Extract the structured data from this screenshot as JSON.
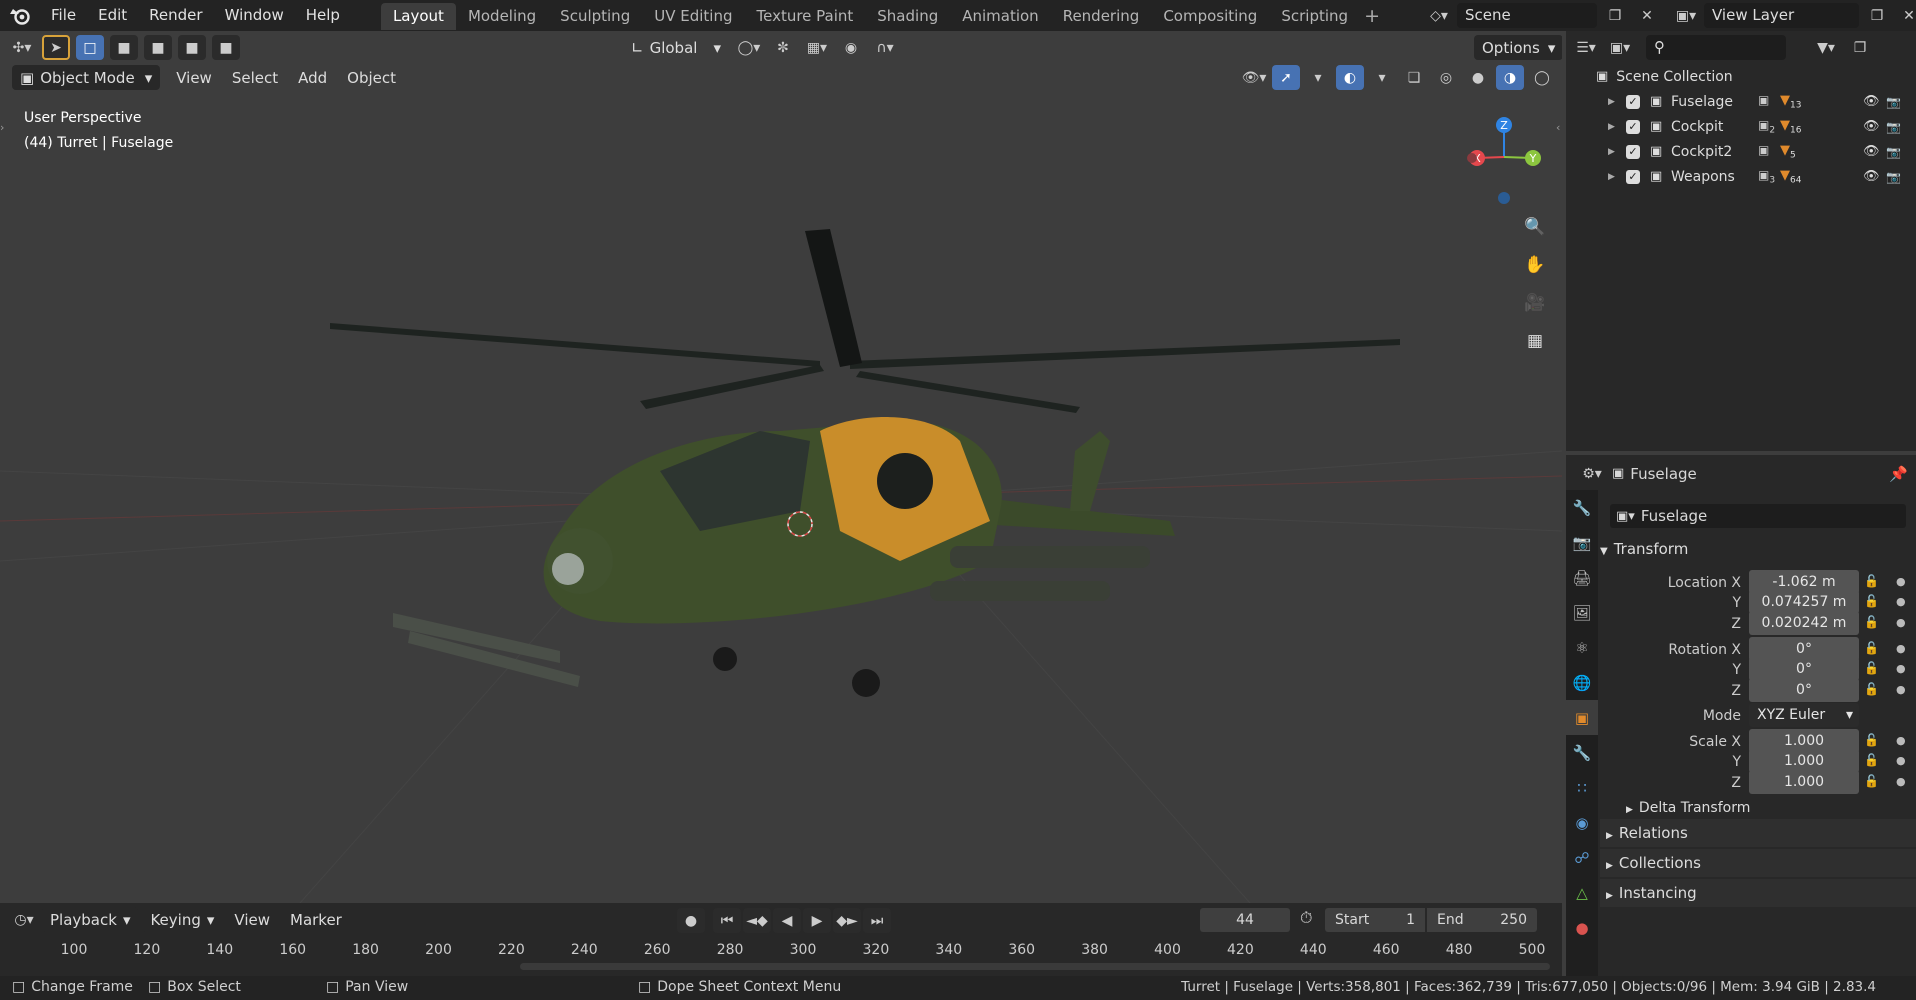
{
  "topbar": {
    "menus": [
      "File",
      "Edit",
      "Render",
      "Window",
      "Help"
    ],
    "tabs": [
      "Layout",
      "Modeling",
      "Sculpting",
      "UV Editing",
      "Texture Paint",
      "Shading",
      "Animation",
      "Rendering",
      "Compositing",
      "Scripting"
    ],
    "active_tab": "Layout",
    "scene_label": "Scene",
    "view_layer_label": "View Layer"
  },
  "viewport": {
    "orientation_label": "Global",
    "options_label": "Options",
    "mode_label": "Object Mode",
    "header_menus": [
      "View",
      "Select",
      "Add",
      "Object"
    ],
    "overlay_line1": "User Perspective",
    "overlay_line2": "(44) Turret | Fuselage",
    "gizmo": {
      "z": "Z",
      "x": "X",
      "y": "Y"
    }
  },
  "outliner": {
    "root": "Scene Collection",
    "items": [
      {
        "name": "Fuselage",
        "count_a": "",
        "count_b": "13"
      },
      {
        "name": "Cockpit",
        "count_a": "2",
        "count_b": "16"
      },
      {
        "name": "Cockpit2",
        "count_a": "",
        "count_b": "5"
      },
      {
        "name": "Weapons",
        "count_a": "3",
        "count_b": "64"
      }
    ]
  },
  "properties": {
    "header_name": "Fuselage",
    "object_name": "Fuselage",
    "transform_label": "Transform",
    "location": {
      "label_x": "Location X",
      "x": "-1.062 m",
      "y": "0.074257 m",
      "z": "0.020242 m"
    },
    "rotation": {
      "label_x": "Rotation X",
      "x": "0°",
      "y": "0°",
      "z": "0°"
    },
    "mode_label": "Mode",
    "mode_value": "XYZ Euler",
    "scale": {
      "label_x": "Scale X",
      "x": "1.000",
      "y": "1.000",
      "z": "1.000"
    },
    "axis_y": "Y",
    "axis_z": "Z",
    "delta": "Delta Transform",
    "relations": "Relations",
    "collections": "Collections",
    "instancing": "Instancing"
  },
  "timeline": {
    "playback": "Playback",
    "keying": "Keying",
    "view": "View",
    "marker": "Marker",
    "current_frame": "44",
    "start_label": "Start",
    "start_value": "1",
    "end_label": "End",
    "end_value": "250",
    "ticks": [
      "100",
      "120",
      "140",
      "160",
      "180",
      "200",
      "220",
      "240",
      "260",
      "280",
      "300",
      "320",
      "340",
      "360",
      "380",
      "400",
      "420",
      "440",
      "460",
      "480",
      "500"
    ]
  },
  "statusbar": {
    "change_frame": "Change Frame",
    "box_select": "Box Select",
    "pan_view": "Pan View",
    "context_menu": "Dope Sheet Context Menu",
    "stats": "Turret | Fuselage | Verts:358,801 | Faces:362,739 | Tris:677,050 | Objects:0/96 | Mem: 3.94 GiB | 2.83.4"
  },
  "colors": {
    "accent": "#4772b3",
    "x_axis": "#e5484d",
    "y_axis": "#8cc63f",
    "z_axis": "#2f84e3",
    "orange": "#e08a2c"
  }
}
